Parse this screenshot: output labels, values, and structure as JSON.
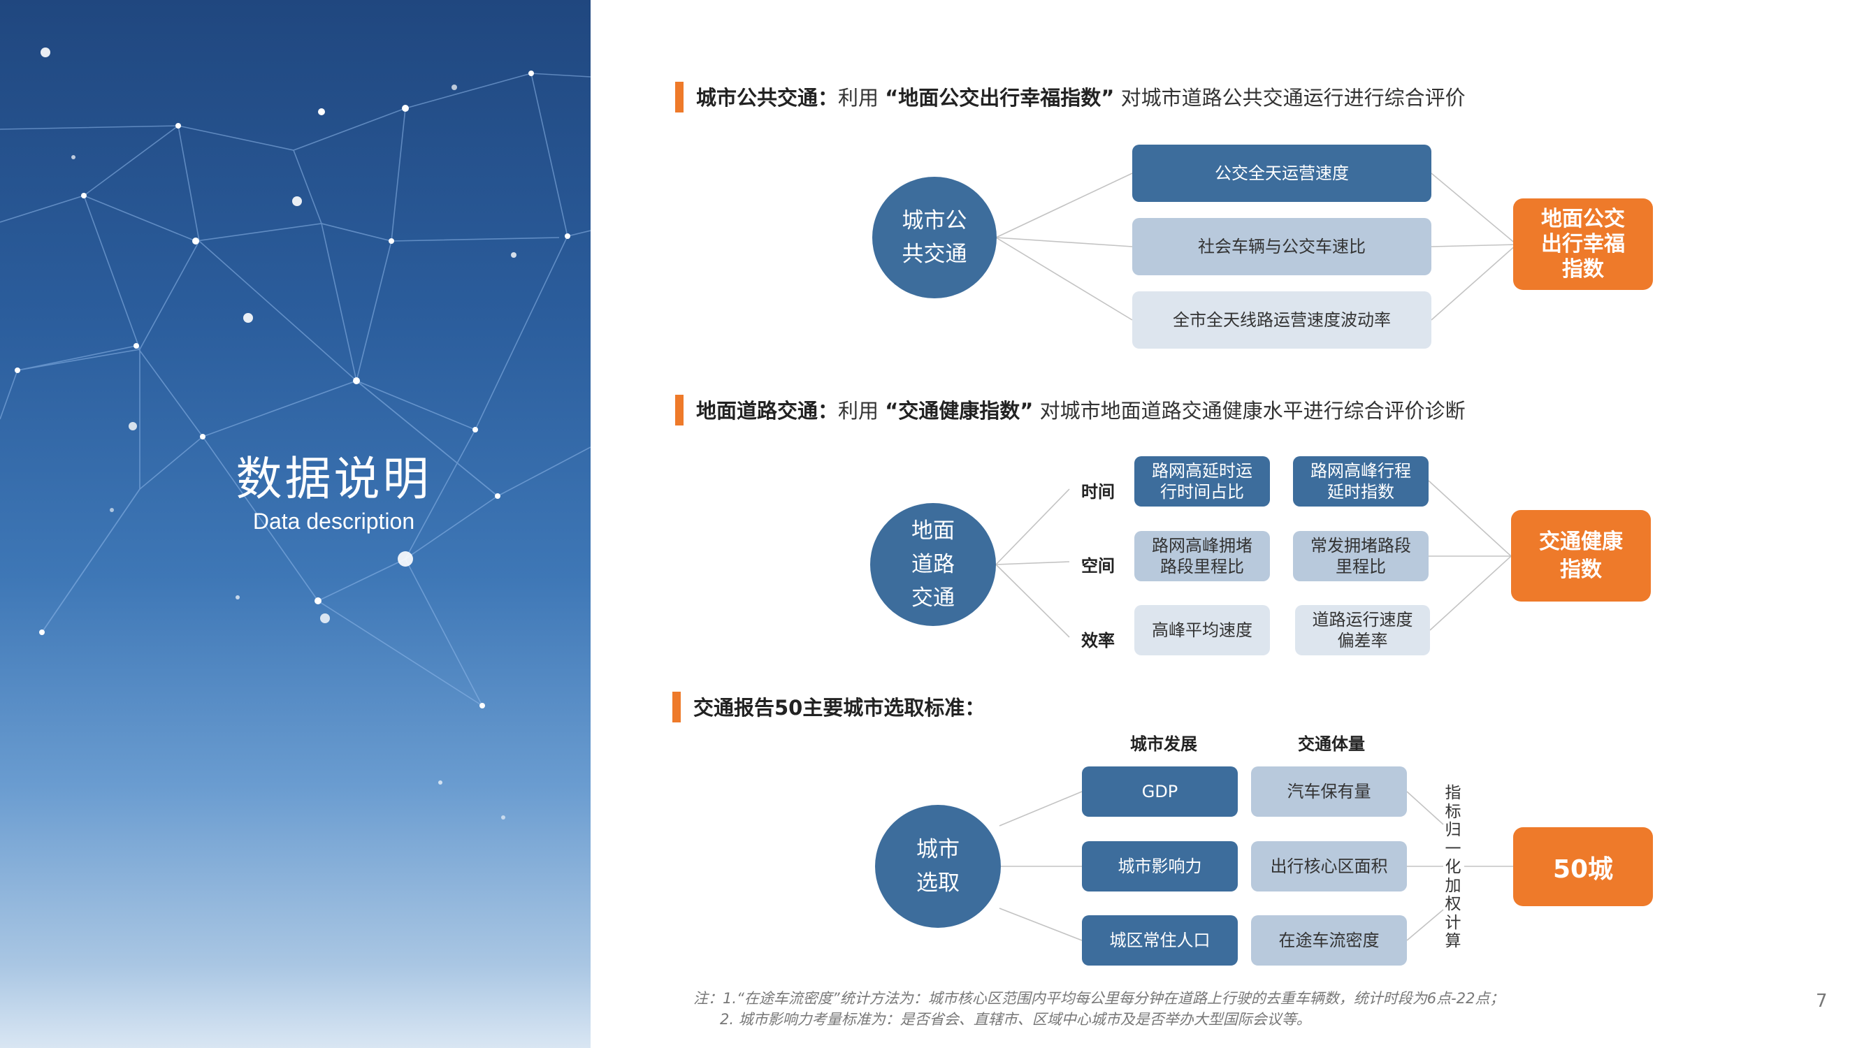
{
  "left_panel": {
    "title": "数据说明",
    "subtitle": "Data description"
  },
  "section1": {
    "bold_prefix": "城市公共交通：",
    "mid1": "利用",
    "bold_index": "“地面公交出行幸福指数”",
    "rest": "对城市道路公共交通运行进行综合评价",
    "circle": "城市公共交通",
    "metrics": [
      "公交全天运营速度",
      "社会车辆与公交车速比",
      "全市全天线路运营速度波动率"
    ],
    "result": "地面公交出行幸福指数"
  },
  "section2": {
    "bold_prefix": "地面道路交通：",
    "mid1": "利用",
    "bold_index": "“交通健康指数”",
    "rest": "对城市地面道路交通健康水平进行综合评价诊断",
    "circle": "地面道路交通",
    "categories": [
      "时间",
      "空间",
      "效率"
    ],
    "metrics": [
      "路网高延时运行时间占比",
      "路网高峰行程延时指数",
      "路网高峰拥堵路段里程比",
      "常发拥堵路段里程比",
      "高峰平均速度",
      "道路运行速度偏差率"
    ],
    "result": "交通健康指数"
  },
  "section3": {
    "heading": "交通报告50主要城市选取标准：",
    "circle": "城市选取",
    "col_headers": [
      "城市发展",
      "交通体量"
    ],
    "dev_items": [
      "GDP",
      "城市影响力",
      "城区常住人口"
    ],
    "volume_items": [
      "汽车保有量",
      "出行核心区面积",
      "在途车流密度"
    ],
    "vertical_text": "指标归一化加权计算",
    "result": "50城"
  },
  "notes": [
    "注：1.“在途车流密度”统计方法为：城市核心区范围内平均每公里每分钟在道路上行驶的去重车辆数，统计时段为6点-22点；",
    "2. 城市影响力考量标准为：是否省会、直辖市、区域中心城市及是否举办大型国际会议等。"
  ],
  "page_number": "7",
  "colors": {
    "accent_orange": "#ee7a2a",
    "dark_blue": "#3d6d9c",
    "mid_blue": "#b8c9dc",
    "light_blue": "#dde5ee"
  }
}
